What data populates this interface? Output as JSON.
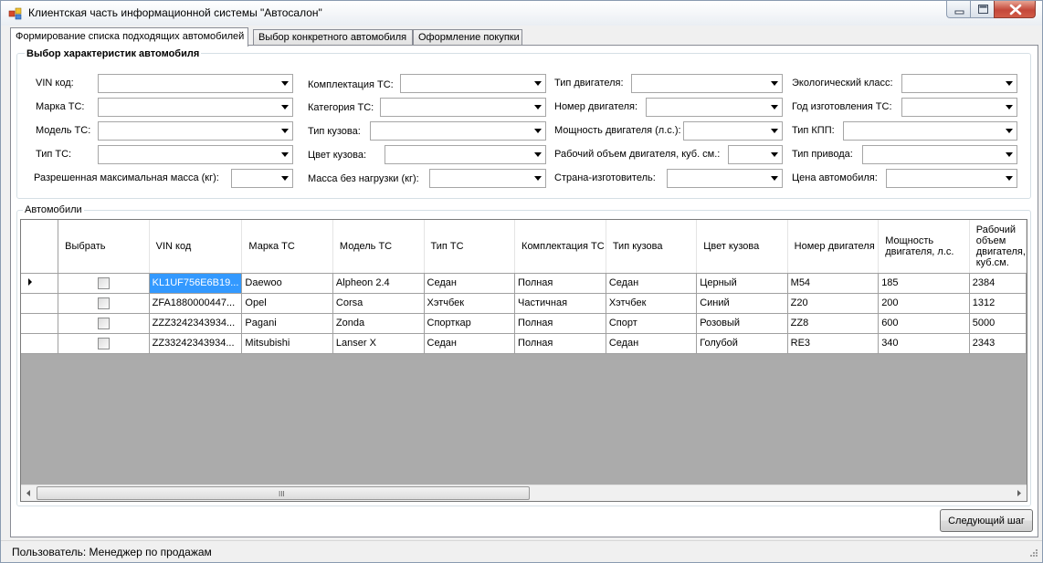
{
  "window": {
    "title": "Клиентская часть информационной системы \"Автосалон\""
  },
  "tabs": [
    {
      "label": "Формирование списка подходящих автомобилей",
      "active": true
    },
    {
      "label": "Выбор конкретного автомобиля",
      "active": false
    },
    {
      "label": "Оформление покупки",
      "active": false
    }
  ],
  "filters": {
    "title": "Выбор характеристик автомобиля",
    "fields": [
      {
        "label": "VIN код:",
        "value": ""
      },
      {
        "label": "Марка ТС:",
        "value": ""
      },
      {
        "label": "Модель ТС:",
        "value": ""
      },
      {
        "label": "Тип ТС:",
        "value": ""
      },
      {
        "label": "Разрешенная максимальная масса (кг):",
        "value": ""
      },
      {
        "label": "Комплектация ТС:",
        "value": ""
      },
      {
        "label": "Категория ТС:",
        "value": ""
      },
      {
        "label": "Тип кузова:",
        "value": ""
      },
      {
        "label": "Цвет кузова:",
        "value": ""
      },
      {
        "label": "Масса без нагрузки (кг):",
        "value": ""
      },
      {
        "label": "Тип двигателя:",
        "value": ""
      },
      {
        "label": "Номер двигателя:",
        "value": ""
      },
      {
        "label": "Мощность двигателя (л.с.):",
        "value": ""
      },
      {
        "label": "Рабочий объем двигателя, куб. см.:",
        "value": ""
      },
      {
        "label": "Страна-изготовитель:",
        "value": ""
      },
      {
        "label": "Экологический класс:",
        "value": ""
      },
      {
        "label": "Год изготовления ТС:",
        "value": ""
      },
      {
        "label": "Тип КПП:",
        "value": ""
      },
      {
        "label": "Тип привода:",
        "value": ""
      },
      {
        "label": "Цена автомобиля:",
        "value": ""
      }
    ]
  },
  "cars": {
    "title": "Автомобили",
    "columns": [
      "Выбрать",
      "VIN код",
      "Марка ТС",
      "Модель ТС",
      "Тип ТС",
      "Комплектация ТС",
      "Тип кузова",
      "Цвет кузова",
      "Номер двигателя",
      "Мощность двигателя, л.с.",
      "Рабочий объем двигателя, куб.см."
    ],
    "rows": [
      {
        "selected": false,
        "current": true,
        "vin": "KL1UF756E6B19...",
        "make": "Daewoo",
        "model": "Alpheon 2.4",
        "type": "Седан",
        "trim": "Полная",
        "body": "Седан",
        "color": "Церный",
        "engine_no": "M54",
        "power": "185",
        "volume": "2384"
      },
      {
        "selected": false,
        "current": false,
        "vin": "ZFA1880000447...",
        "make": "Opel",
        "model": "Corsa",
        "type": "Хэтчбек",
        "trim": "Частичная",
        "body": "Хэтчбек",
        "color": "Синий",
        "engine_no": "Z20",
        "power": "200",
        "volume": "1312"
      },
      {
        "selected": false,
        "current": false,
        "vin": "ZZZ3242343934...",
        "make": "Pagani",
        "model": "Zonda",
        "type": "Спорткар",
        "trim": "Полная",
        "body": "Спорт",
        "color": "Розовый",
        "engine_no": "ZZ8",
        "power": "600",
        "volume": "5000"
      },
      {
        "selected": false,
        "current": false,
        "vin": "ZZ33242343934...",
        "make": "Mitsubishi",
        "model": "Lanser X",
        "type": "Седан",
        "trim": "Полная",
        "body": "Седан",
        "color": "Голубой",
        "engine_no": "RE3",
        "power": "340",
        "volume": "2343"
      }
    ],
    "scroll_grip": "III"
  },
  "actions": {
    "next_label": "Следующий шаг"
  },
  "status": {
    "text": "Пользователь: Менеджер по продажам"
  },
  "icons": {
    "app": "app-window-icon",
    "minimize": "minimize-icon",
    "maximize": "maximize-icon",
    "close": "close-icon"
  },
  "colors": {
    "selection": "#3399ff",
    "close_button": "#c4483a"
  }
}
